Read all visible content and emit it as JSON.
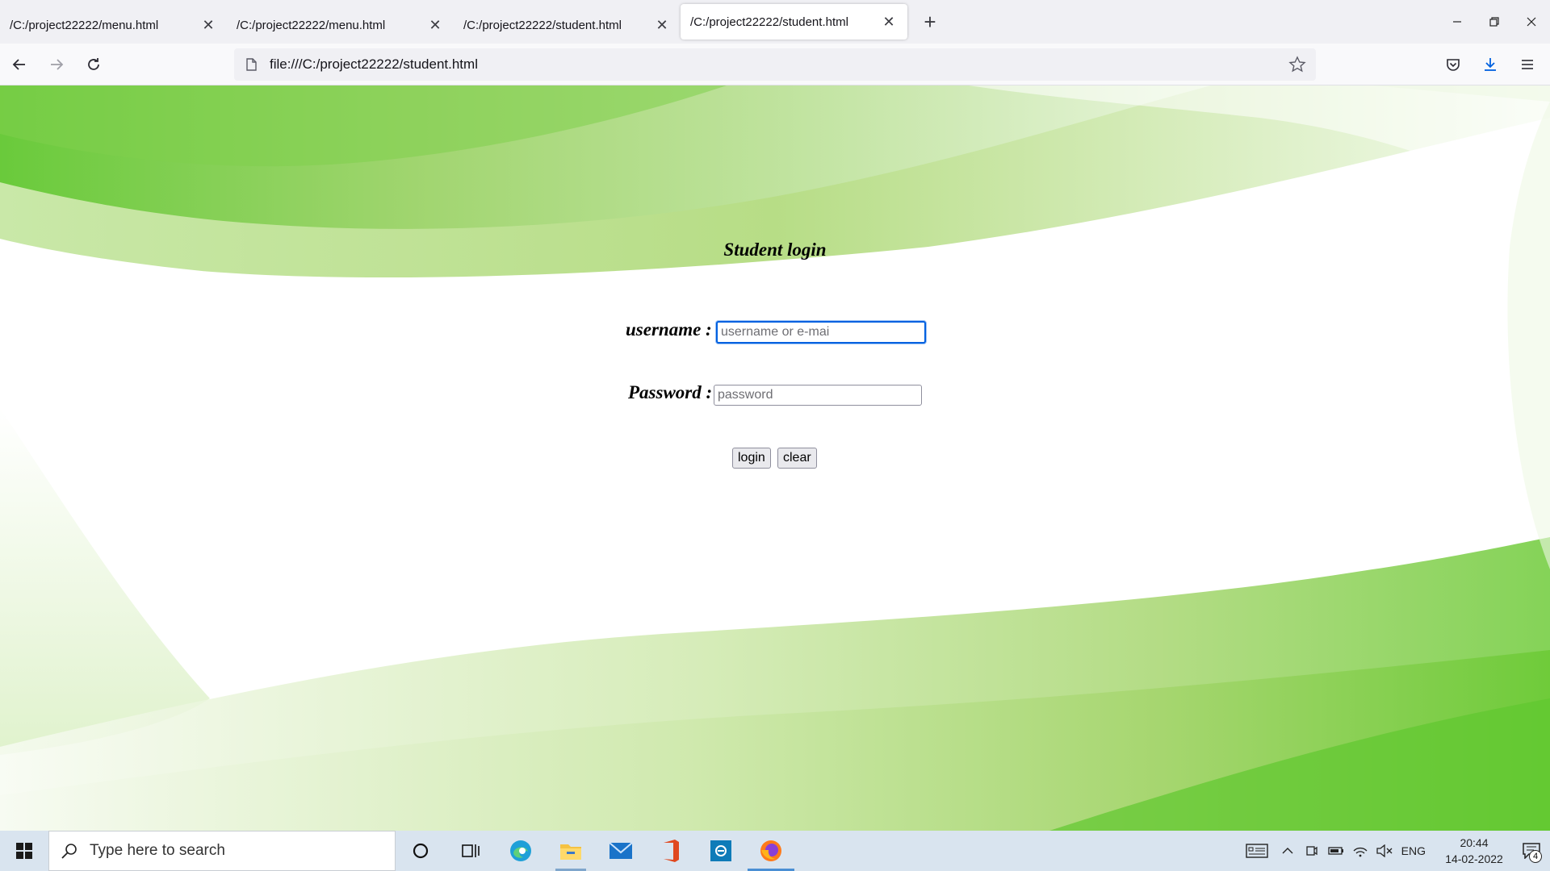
{
  "browser": {
    "tabs": [
      {
        "title": "/C:/project22222/menu.html",
        "active": false
      },
      {
        "title": "/C:/project22222/menu.html",
        "active": false
      },
      {
        "title": "/C:/project22222/student.html",
        "active": false
      },
      {
        "title": "/C:/project22222/student.html",
        "active": true
      }
    ],
    "url": "file:///C:/project22222/student.html"
  },
  "page": {
    "heading": "Student login",
    "username_label": "username :",
    "username_placeholder": "username or e-mai",
    "password_label": "Password :",
    "password_placeholder": "password",
    "login_button": "login",
    "clear_button": "clear",
    "background_colors": {
      "green_dark": "#5fc72f",
      "green_mid": "#a8d87a",
      "green_light": "#d8efc0"
    }
  },
  "taskbar": {
    "search_placeholder": "Type here to search",
    "language": "ENG",
    "time": "20:44",
    "date": "14-02-2022",
    "notification_count": "4",
    "accent_color": "#4a8fd4"
  }
}
